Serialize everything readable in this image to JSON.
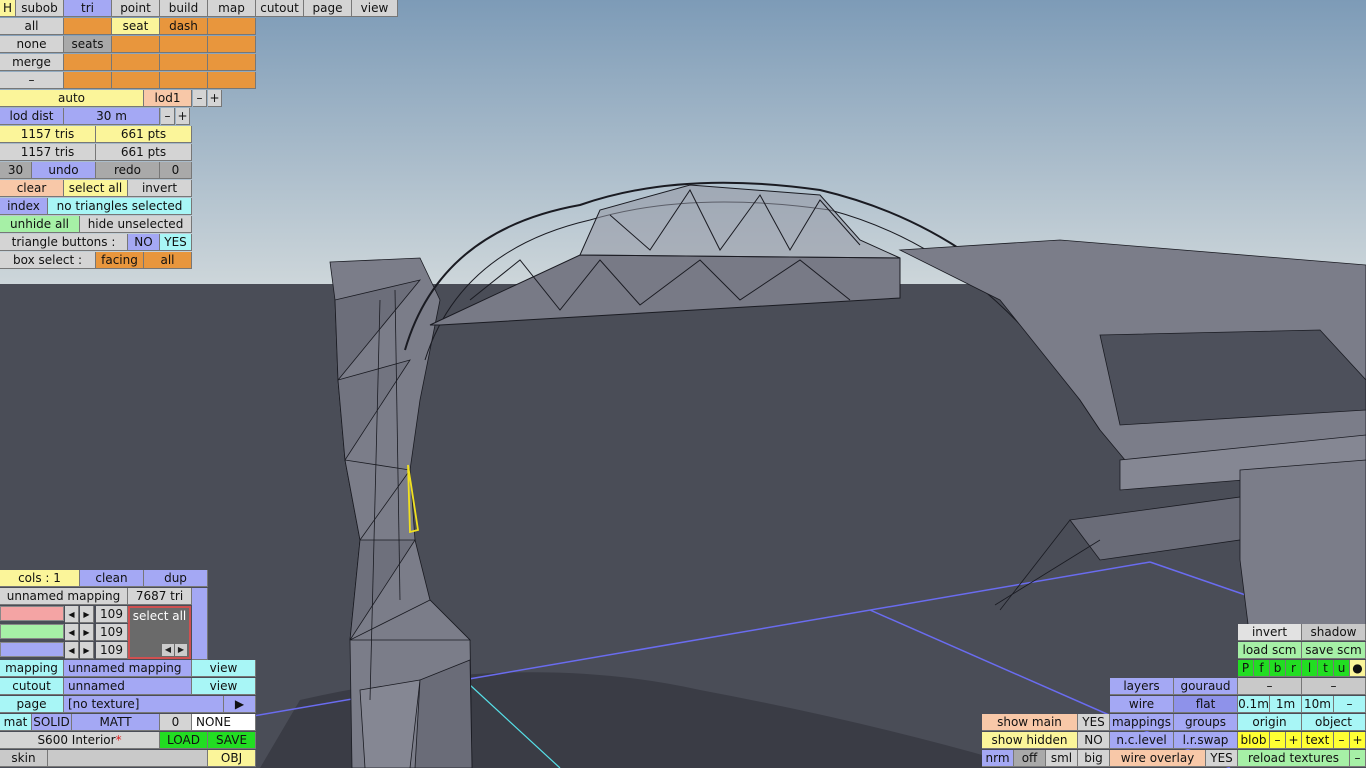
{
  "top_tabs": {
    "h": "H",
    "subob": "subob",
    "tri": "tri",
    "point": "point",
    "build": "build",
    "map": "map",
    "cutout": "cutout",
    "page": "page",
    "view": "view"
  },
  "rows": {
    "all": "all",
    "seat": "seat",
    "dash": "dash",
    "none": "none",
    "seats": "seats",
    "merge": "merge",
    "minus": "–"
  },
  "lod": {
    "auto": "auto",
    "lod1": "lod1",
    "minus": "–",
    "plus": "+",
    "lod_dist_label": "lod dist",
    "lod_dist_value": "30 m"
  },
  "stats": {
    "tris1": "1157 tris",
    "pts1": "661 pts",
    "tris2": "1157 tris",
    "pts2": "661 pts"
  },
  "undo_row": {
    "count": "30",
    "undo": "undo",
    "redo": "redo",
    "redo_count": "0"
  },
  "select_row": {
    "clear": "clear",
    "select_all": "select all",
    "invert": "invert"
  },
  "index_row": {
    "index": "index",
    "status": "no triangles selected"
  },
  "hide_row": {
    "unhide_all": "unhide all",
    "hide_unselected": "hide unselected"
  },
  "tri_buttons": {
    "label": "triangle buttons :",
    "no": "NO",
    "yes": "YES"
  },
  "box_select": {
    "label": "box select :",
    "facing": "facing",
    "all": "all"
  },
  "mapping_panel": {
    "cols": "cols : 1",
    "clean": "clean",
    "dup": "dup",
    "mapping_name": "unnamed mapping",
    "tri_count": "7687 tri",
    "v1": "109",
    "v2": "109",
    "v3": "109",
    "select_all": "select all",
    "arrow_left": "◀",
    "arrow_right": "▶"
  },
  "bottom_left": {
    "mapping_label": "mapping",
    "mapping_value": "unnamed mapping",
    "view1": "view",
    "cutout_label": "cutout",
    "cutout_value": "unnamed",
    "view2": "view",
    "page_label": "page",
    "page_value": "[no texture]",
    "page_arrow": "▶",
    "mat": "mat",
    "solid": "SOLID",
    "matt": "MATT",
    "zero": "0",
    "none": "NONE",
    "file": "S600 Interior",
    "star": "*",
    "load": "LOAD",
    "save": "SAVE",
    "skin": "skin",
    "obj": "OBJ"
  },
  "bottom_right": {
    "show_main": "show main",
    "show_main_val": "YES",
    "show_hidden": "show hidden",
    "show_hidden_val": "NO",
    "nrm": "nrm",
    "off": "off",
    "sml": "sml",
    "big": "big",
    "layers": "layers",
    "gouraud": "gouraud",
    "wire": "wire",
    "flat": "flat",
    "mappings": "mappings",
    "groups": "groups",
    "nclevel": "n.c.level",
    "lrswap": "l.r.swap",
    "wire_overlay": "wire overlay",
    "wire_overlay_val": "YES",
    "invert": "invert",
    "shadow": "shadow",
    "load_scm": "load scm",
    "save_scm": "save scm",
    "views": [
      "P",
      "f",
      "b",
      "r",
      "l",
      "t",
      "u",
      "●"
    ],
    "dash1": "–",
    "dash2": "–",
    "d01": "0.1m",
    "d1": "1m",
    "d10": "10m",
    "dminus": "–",
    "origin": "origin",
    "object": "object",
    "blob": "blob",
    "blob_minus": "–",
    "blob_plus": "+",
    "text": "text",
    "text_minus": "–",
    "text_plus": "+",
    "reload": "reload textures",
    "reload_minus": "–"
  },
  "colors": {
    "sky_top": "#7d9bb7",
    "sky_bottom": "#c9d3d8",
    "ground": "#4a4d57",
    "mesh_fill": "#7a7c88",
    "mesh_line": "#1a1b22",
    "axis_blue": "#6a6cf0",
    "axis_cyan": "#56e0e8",
    "selection": "#f0e020"
  }
}
